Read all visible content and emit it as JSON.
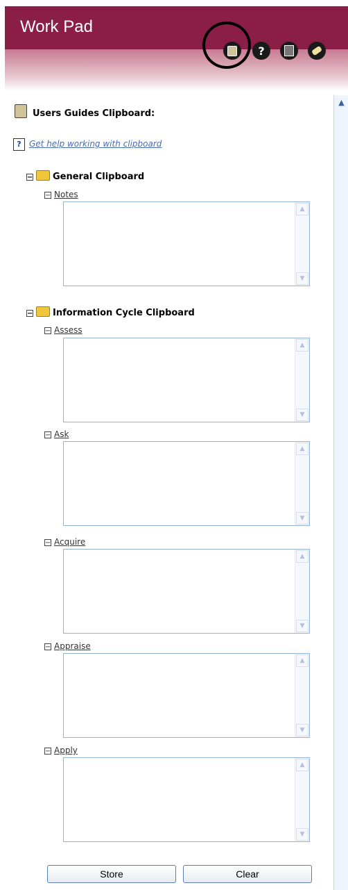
{
  "header": {
    "title": "Work Pad",
    "icons": [
      "clipboard-icon",
      "help-icon",
      "calculator-icon",
      "eraser-icon"
    ]
  },
  "page": {
    "title": "Users Guides Clipboard:"
  },
  "help": {
    "link_text": "Get help working with clipboard",
    "icon_glyph": "?"
  },
  "sections": [
    {
      "label": "General Clipboard",
      "fields": [
        {
          "label": "Notes",
          "value": ""
        }
      ]
    },
    {
      "label": "Information Cycle Clipboard",
      "fields": [
        {
          "label": "Assess",
          "value": ""
        },
        {
          "label": "Ask",
          "value": ""
        },
        {
          "label": "Acquire",
          "value": ""
        },
        {
          "label": "Appraise",
          "value": ""
        },
        {
          "label": "Apply",
          "value": ""
        }
      ]
    }
  ],
  "buttons": {
    "store": "Store",
    "clear": "Clear"
  },
  "glyphs": {
    "minus": "−",
    "up": "▲",
    "down": "▼"
  }
}
